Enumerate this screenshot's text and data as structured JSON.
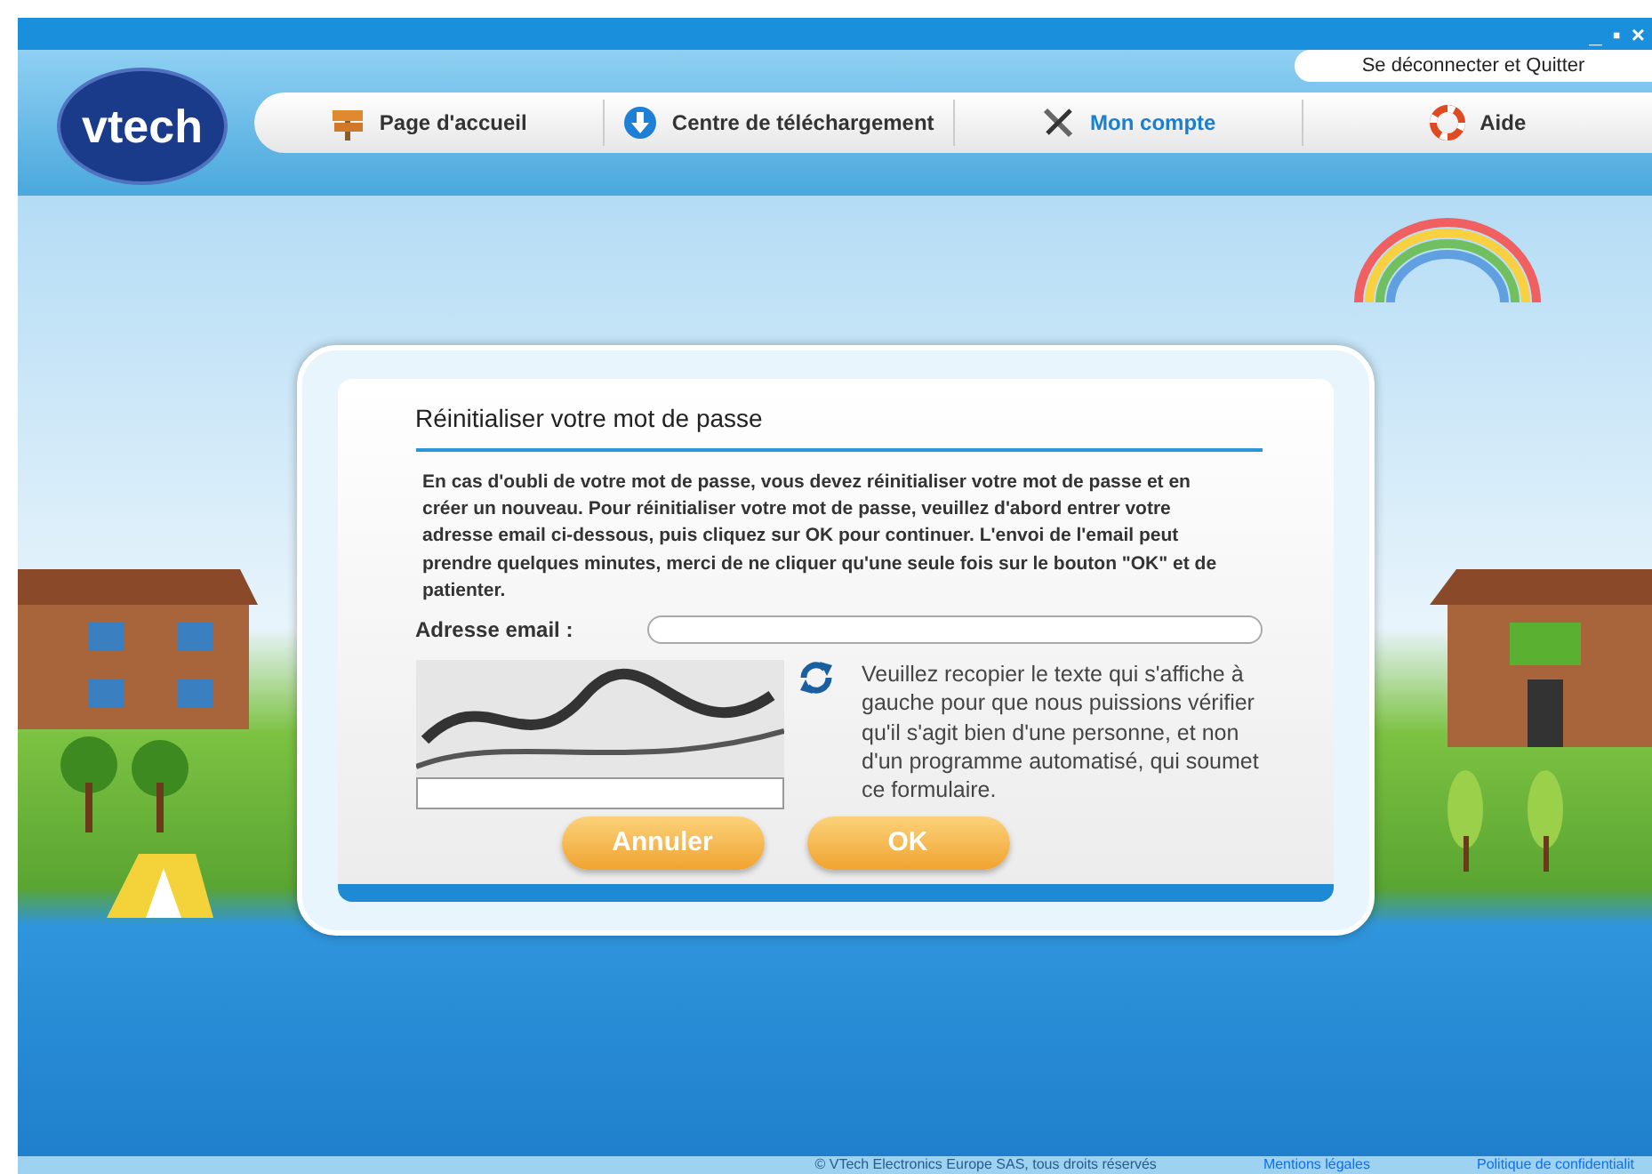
{
  "window": {
    "controls": [
      "_",
      "▪",
      "×"
    ]
  },
  "header": {
    "logo": "vtech",
    "logout": "Se déconnecter et Quitter",
    "nav": [
      {
        "label": "Page d'accueil",
        "kind": "signpost",
        "selected": false
      },
      {
        "label": "Centre de téléchargement",
        "kind": "download",
        "selected": false
      },
      {
        "label": "Mon compte",
        "kind": "tools",
        "selected": true
      },
      {
        "label": "Aide",
        "kind": "lifebuoy",
        "selected": false
      }
    ]
  },
  "dialog": {
    "title": "Réinitialiser votre mot de passe",
    "intro": "En cas d'oubli de votre mot de passe, vous devez réinitialiser votre mot de passe et en créer un nouveau. Pour réinitialiser votre mot de passe, veuillez d'abord entrer votre adresse email ci-dessous, puis cliquez sur OK pour continuer. L'envoi de l'email peut prendre quelques minutes, merci de ne cliquer qu'une seule fois sur le bouton \"OK\" et de patienter.",
    "email_label": "Adresse email :",
    "captcha_hint": "Veuillez recopier le texte qui s'affiche à gauche pour que nous puissions vérifier qu'il s'agit bien d'une personne, et non d'un programme automatisé, qui soumet ce formulaire.",
    "buttons": [
      "Annuler",
      "OK"
    ]
  },
  "footer": {
    "copyright": "© VTech Electronics Europe SAS, tous droits réservés",
    "links": [
      "Mentions légales",
      "Politique de confidentialit"
    ]
  }
}
